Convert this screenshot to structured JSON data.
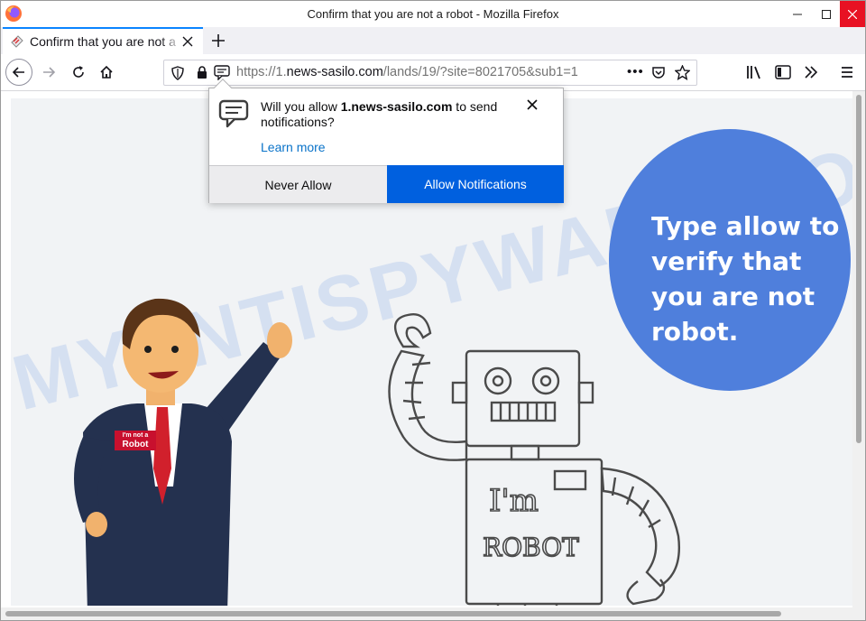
{
  "window": {
    "title": "Confirm that you are not a robot - Mozilla Firefox"
  },
  "tab": {
    "title": "Confirm that you are not a robot",
    "icon": "notification-tab-icon"
  },
  "urlbar": {
    "url_prefix": "https://1.",
    "url_domain": "news-sasilo.com",
    "url_path": "/lands/19/?site=8021705&sub1=1",
    "more_label": "•••"
  },
  "popup": {
    "message_pre": "Will you allow ",
    "message_domain": "1.news-sasilo.com",
    "message_post": " to send notifications?",
    "learn_more": "Learn more",
    "never_allow": "Never Allow",
    "allow": "Allow Notifications"
  },
  "page": {
    "circle_text": "Type allow to verify that you are not robot.",
    "badge_line1": "I'm not a",
    "badge_line2": "Robot",
    "robot_text_1": "I'm",
    "robot_text_2": "ROBOT",
    "watermark": "MYANTISPYWARE.COM"
  },
  "colors": {
    "accent": "#0060df",
    "circle": "#4f7fdc",
    "close_button": "#e81123"
  }
}
